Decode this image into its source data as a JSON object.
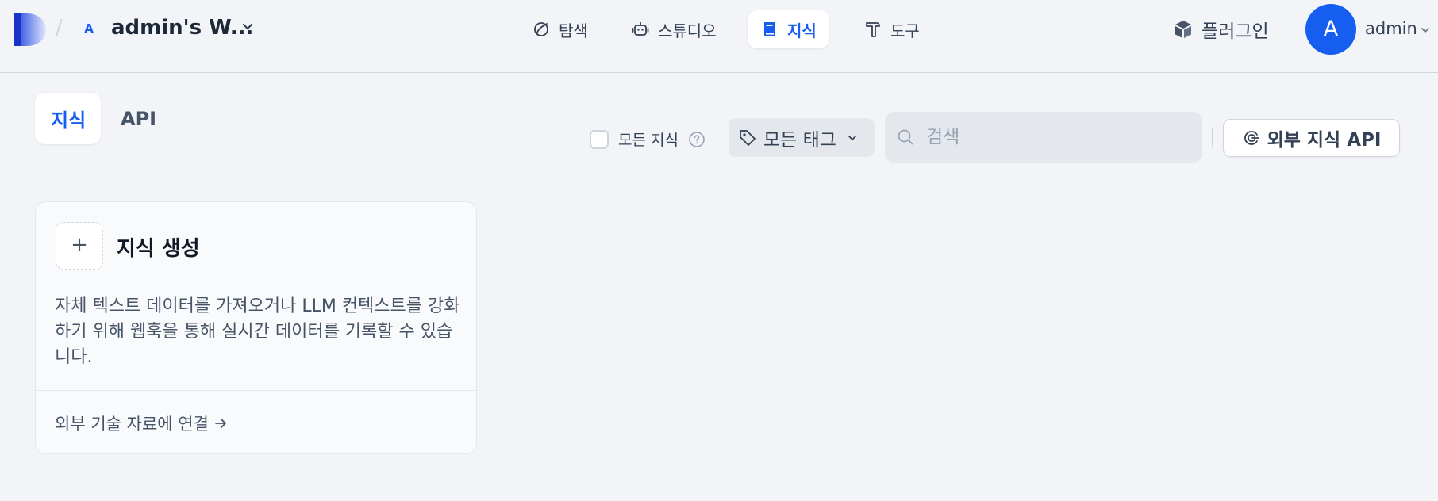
{
  "header": {
    "workspace_initial": "A",
    "workspace_name": "admin's W...",
    "nav": [
      {
        "label": "탐색",
        "icon": "compass-icon"
      },
      {
        "label": "스튜디오",
        "icon": "robot-icon"
      },
      {
        "label": "지식",
        "icon": "book-icon",
        "active": true
      },
      {
        "label": "도구",
        "icon": "hammer-icon"
      }
    ],
    "plugin_label": "플러그인",
    "user_initial": "A",
    "user_name": "admin"
  },
  "toolbar": {
    "tabs": [
      {
        "label": "지식",
        "active": true
      },
      {
        "label": "API",
        "active": false
      }
    ],
    "all_knowledge_label": "모든 지식",
    "tag_filter_label": "모든 태그",
    "search_placeholder": "검색",
    "external_api_label": "외부 지식 API"
  },
  "create_card": {
    "plus": "+",
    "title": "지식 생성",
    "description": "자체 텍스트 데이터를 가져오거나 LLM 컨텍스트를 강화하기 위해 웹훅을 통해 실시간 데이터를 기록할 수 있습니다.",
    "link_label": "외부 기술 자료에 연결"
  },
  "colors": {
    "accent": "#155eef",
    "background": "#f2f4f7",
    "text": "#101828"
  }
}
